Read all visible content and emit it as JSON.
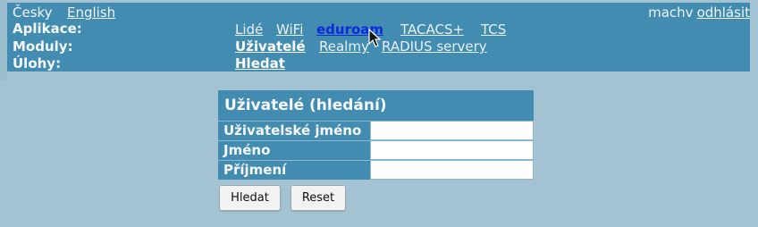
{
  "header": {
    "languages": [
      "Česky",
      "English"
    ],
    "user": "machv",
    "logout_label": "odhlásit",
    "rows": {
      "applications_label": "Aplikace:",
      "modules_label": "Moduly:",
      "tasks_label": "Úlohy:"
    },
    "applications": [
      "Lidé",
      "WiFi",
      "eduroam",
      "TACACS+",
      "TCS"
    ],
    "modules": [
      "Uživatelé",
      "Realmy",
      "RADIUS servery"
    ],
    "tasks": [
      "Hledat"
    ]
  },
  "form": {
    "title": "Uživatelé (hledání)",
    "fields": [
      {
        "label": "Uživatelské jméno",
        "value": ""
      },
      {
        "label": "Jméno",
        "value": ""
      },
      {
        "label": "Příjmení",
        "value": ""
      }
    ],
    "search_button": "Hledat",
    "reset_button": "Reset"
  },
  "colors": {
    "background": "#a3c3d3",
    "panel": "#428bb1",
    "active_link": "#0a2cd6"
  }
}
